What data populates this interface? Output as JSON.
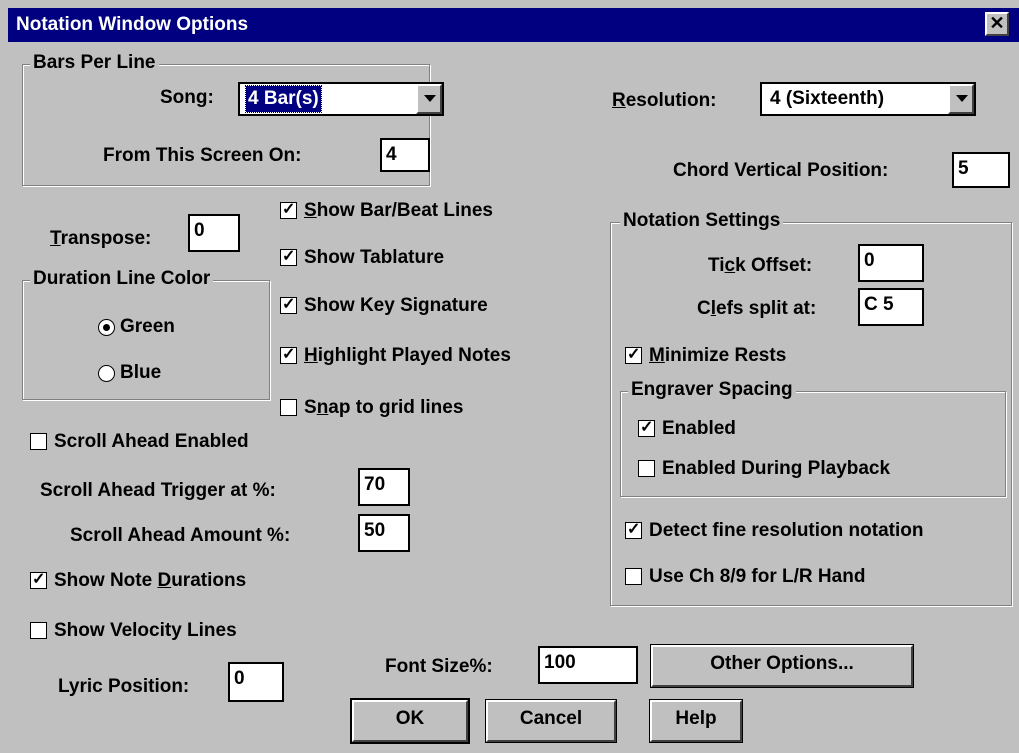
{
  "title": "Notation Window Options",
  "close_glyph": "✕",
  "bars_per_line": {
    "legend": "Bars Per Line",
    "song_label": "Song:",
    "song_value": "4 Bar(s)",
    "from_screen_label": "From This Screen On:",
    "from_screen_value": "4"
  },
  "resolution": {
    "label_u": "R",
    "label_rest": "esolution:",
    "value": "4 (Sixteenth)"
  },
  "chord_vertical": {
    "label": "Chord Vertical Position:",
    "value": "5"
  },
  "transpose": {
    "label_u": "T",
    "label_rest": "ranspose:",
    "value": "0"
  },
  "show_options": [
    {
      "u": "S",
      "rest": "how Bar/Beat Lines",
      "checked": true
    },
    {
      "u": "",
      "rest": "Show Tablature",
      "checked": true
    },
    {
      "u": "",
      "rest": "Show Key Signature",
      "checked": true
    },
    {
      "u": "H",
      "rest": "ighlight Played Notes",
      "checked": true
    },
    {
      "pre": "S",
      "u": "n",
      "rest": "ap to grid lines",
      "checked": false
    }
  ],
  "duration_color": {
    "legend": "Duration Line Color",
    "options": [
      {
        "label": "Green",
        "selected": true
      },
      {
        "label": "Blue",
        "selected": false
      }
    ]
  },
  "notation_settings": {
    "legend": "Notation Settings",
    "tick_offset_pre": "Ti",
    "tick_offset_u": "c",
    "tick_offset_rest": "k Offset:",
    "tick_offset_value": "0",
    "clefs_pre": "C",
    "clefs_u": "l",
    "clefs_rest": "efs split at:",
    "clefs_value": "C 5",
    "minimize_u": "M",
    "minimize_rest": "inimize Rests",
    "minimize_checked": true,
    "engraver_legend": "Engraver Spacing",
    "engraver_enabled": "Enabled",
    "engraver_enabled_checked": true,
    "engraver_playback": "Enabled During Playback",
    "engraver_playback_checked": false,
    "detect_fine": "Detect fine resolution notation",
    "detect_fine_checked": true,
    "use_ch": "Use Ch 8/9 for L/R Hand",
    "use_ch_checked": false
  },
  "scroll_ahead": {
    "enabled_label": "Scroll Ahead Enabled",
    "enabled_checked": false,
    "trigger_label": "Scroll Ahead Trigger at %:",
    "trigger_value": "70",
    "amount_label": "Scroll Ahead Amount %:",
    "amount_value": "50"
  },
  "show_note_durations": {
    "pre": "Show Note ",
    "u": "D",
    "rest": "urations",
    "checked": true
  },
  "show_velocity": {
    "label": "Show Velocity Lines",
    "checked": false
  },
  "lyric_position": {
    "label": "Lyric Position:",
    "value": "0"
  },
  "font_size": {
    "label": "Font Size%:",
    "value": "100"
  },
  "buttons": {
    "other": "Other Options...",
    "ok": "OK",
    "cancel": "Cancel",
    "help": "Help"
  }
}
